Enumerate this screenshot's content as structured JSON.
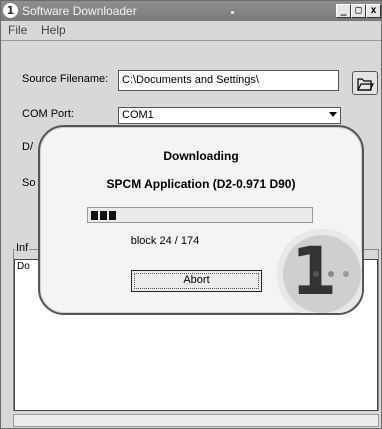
{
  "window": {
    "title": "Software Downloader",
    "icon": "one-logo-icon",
    "controls": [
      "_",
      "□",
      "x"
    ]
  },
  "menu": {
    "file": "File",
    "help": "Help"
  },
  "form": {
    "source_label": "Source Filename:",
    "source_value": "C:\\Documents and Settings\\",
    "com_label": "COM Port:",
    "com_value": "COM1",
    "row3_label_partial": "D/",
    "row4_label_partial": "So"
  },
  "info": {
    "group_label_partial": "Inf",
    "log_text_partial": "Do"
  },
  "dialog": {
    "title": "Downloading",
    "subtitle": "SPCM Application (D2-0.971 D90)",
    "progress_fraction": 0.1379,
    "progress_blocks_filled": 3,
    "block_status": "block 24 / 174",
    "abort_label": "Abort"
  }
}
